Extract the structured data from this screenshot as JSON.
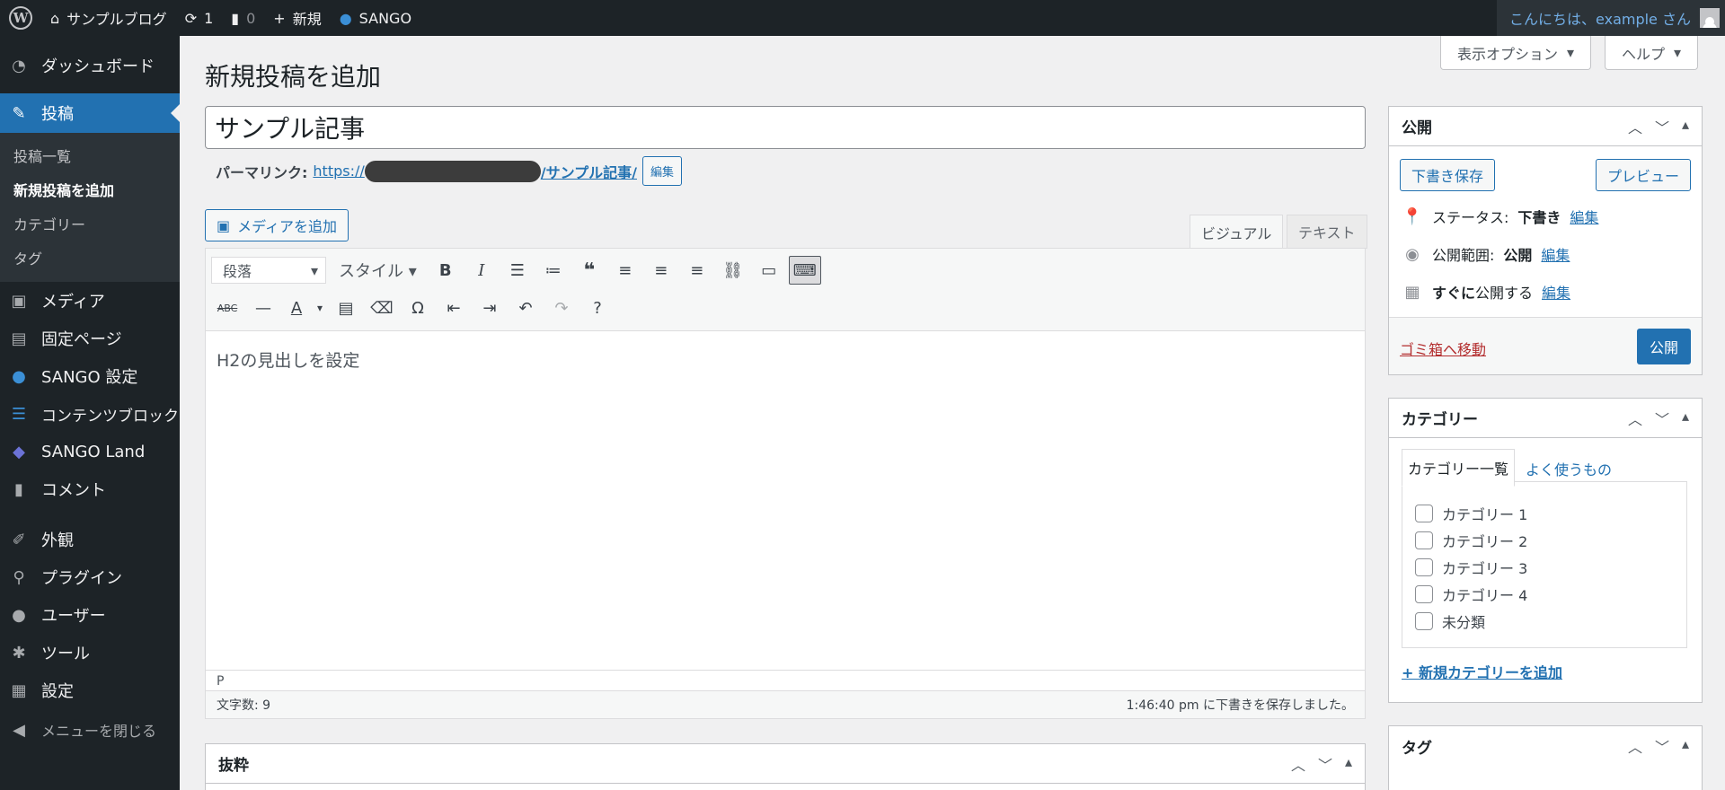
{
  "adminbar": {
    "site_name": "サンプルブログ",
    "updates_count": "1",
    "comments_count": "0",
    "new_label": "新規",
    "sango_label": "SANGO",
    "greeting": "こんにちは、example さん"
  },
  "sidebar": {
    "dashboard": "ダッシュボード",
    "posts": "投稿",
    "submenu": [
      "投稿一覧",
      "新規投稿を追加",
      "カテゴリー",
      "タグ"
    ],
    "media": "メディア",
    "pages": "固定ページ",
    "sango_settings": "SANGO 設定",
    "content_blocks": "コンテンツブロック",
    "sango_land": "SANGO Land",
    "comments": "コメント",
    "appearance": "外観",
    "plugins": "プラグイン",
    "users": "ユーザー",
    "tools": "ツール",
    "settings": "設定",
    "collapse": "メニューを閉じる"
  },
  "screen_options": {
    "display": "表示オプション",
    "help": "ヘルプ"
  },
  "page": {
    "title": "新規投稿を追加",
    "post_title": "サンプル記事",
    "permalink_label": "パーマリンク:",
    "permalink_prefix": "https://",
    "permalink_slug": "/サンプル記事/",
    "permalink_edit": "編集",
    "add_media": "メディアを追加",
    "tab_visual": "ビジュアル",
    "tab_text": "テキスト"
  },
  "editor": {
    "format_select": "段落",
    "style_menu": "スタイル",
    "content": "H2の見出しを設定",
    "path": "P",
    "word_count": "文字数: 9",
    "save_status": "1:46:40 pm に下書きを保存しました。"
  },
  "excerpt": {
    "title": "抜粋"
  },
  "publish": {
    "title": "公開",
    "save_draft": "下書き保存",
    "preview": "プレビュー",
    "status_label": "ステータス:",
    "status_value": "下書き",
    "visibility_label": "公開範囲:",
    "visibility_value": "公開",
    "schedule_bold": "すぐに",
    "schedule_text": "公開する",
    "edit": "編集",
    "trash": "ゴミ箱へ移動",
    "publish_button": "公開"
  },
  "categories": {
    "title": "カテゴリー",
    "tab_all": "カテゴリー一覧",
    "tab_popular": "よく使うもの",
    "items": [
      "カテゴリー 1",
      "カテゴリー 2",
      "カテゴリー 3",
      "カテゴリー 4",
      "未分類"
    ],
    "add_new": "+ 新規カテゴリーを追加"
  },
  "tags": {
    "title": "タグ"
  }
}
